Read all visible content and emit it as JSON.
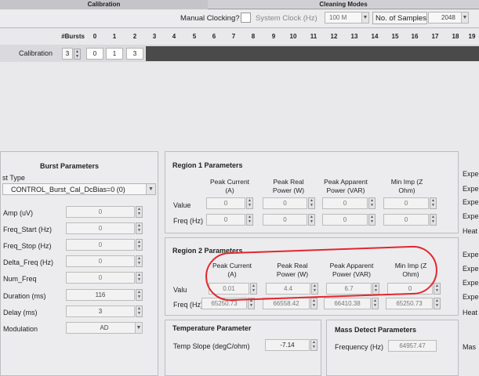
{
  "tabs": {
    "calibration": "Calibration",
    "cleaning": "Cleaning Modes"
  },
  "toolbar": {
    "manual_clocking_label": "Manual Clocking?",
    "system_clock_label": "System Clock (Hz)",
    "system_clock_value": "100 M",
    "samples_label": "No. of Samples",
    "samples_value": "2048"
  },
  "burst_grid": {
    "header_label": "#Bursts",
    "columns": [
      "0",
      "1",
      "2",
      "3",
      "4",
      "5",
      "6",
      "7",
      "8",
      "9",
      "10",
      "11",
      "12",
      "13",
      "14",
      "15",
      "16",
      "17",
      "18",
      "19"
    ],
    "row_label": "Calibration",
    "row_count": "3",
    "row_values": [
      "0",
      "1",
      "3"
    ]
  },
  "burst_params": {
    "title": "Burst Parameters",
    "type_label": "st Type",
    "type_value": "CONTROL_Burst_Cal_DcBias=0 (0)",
    "fields": [
      {
        "label": "Amp (uV)",
        "value": "0"
      },
      {
        "label": "Freq_Start (Hz)",
        "value": "0"
      },
      {
        "label": "Freq_Stop (Hz)",
        "value": "0"
      },
      {
        "label": "Delta_Freq (Hz)",
        "value": "0"
      },
      {
        "label": "Num_Freq",
        "value": "0"
      },
      {
        "label": "Duration (ms)",
        "value": "116"
      },
      {
        "label": "Delay (ms)",
        "value": "3"
      }
    ],
    "modulation_label": "Modulation",
    "modulation_value": "AD"
  },
  "region1": {
    "title": "Region 1 Parameters",
    "headers": [
      "Peak Current (A)",
      "Peak Real Power (W)",
      "Peak Apparent Power (VAR)",
      "Min Imp (Z Ohm)"
    ],
    "value_label": "Value",
    "values": [
      "0",
      "0",
      "0",
      "0"
    ],
    "freq_label": "Freq (Hz)",
    "freqs": [
      "0",
      "0",
      "0",
      "0"
    ]
  },
  "region2": {
    "title": "Region 2 Parameters",
    "headers": [
      "Peak Current (A)",
      "Peak Real Power (W)",
      "Peak Apparent Power (VAR)",
      "Min Imp (Z Ohm)"
    ],
    "value_label": "Valu",
    "values": [
      "0.01",
      "4.4",
      "6.7",
      "0"
    ],
    "freq_label": "Freq (Hz)",
    "freqs": [
      "65250.73",
      "66558.42",
      "66410.38",
      "65250.73"
    ]
  },
  "temperature": {
    "title": "Temperature Parameter",
    "label": "Temp Slope (degC/ohm)",
    "value": "-7.14"
  },
  "mass": {
    "title": "Mass Detect Parameters",
    "label": "Frequency (Hz)",
    "value": "64957.47",
    "right_label": "Mas"
  },
  "right_labels": [
    "Expe",
    "Expe",
    "Expe",
    "Expe",
    "Heat",
    "Expe",
    "Expe",
    "Expe",
    "Expe",
    "Heat"
  ],
  "annotation": {
    "color": "#e3272c"
  }
}
